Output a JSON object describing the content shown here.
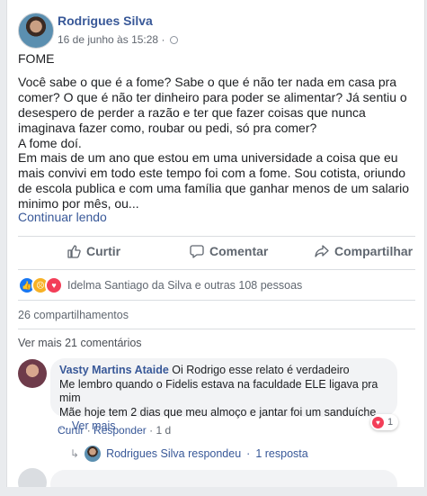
{
  "post": {
    "author": "Rodrigues Silva",
    "timestamp": "16 de junho às 15:28",
    "privacy_sep": "·",
    "title_line": "FOME",
    "paragraph1": "Você sabe o que é a fome? Sabe o que é não ter nada em casa pra comer? O que é não ter dinheiro para poder se alimentar? Já sentiu o desespero de perder a razão e ter que fazer coisas que nunca imaginava fazer como, roubar ou pedi, só pra comer?",
    "line2": "A fome doí.",
    "paragraph3": "Em mais de um ano que estou em uma universidade a coisa que eu mais convivi em todo este tempo foi com a fome. Sou cotista, oriundo de escola publica e com uma família que ganhar menos de um salario minimo por mês, ou...",
    "see_more": "Continuar lendo"
  },
  "actions": {
    "like": "Curtir",
    "comment": "Comentar",
    "share": "Compartilhar"
  },
  "reactions": {
    "icons": [
      "like-icon",
      "sad-icon",
      "love-icon"
    ],
    "summary": "Idelma Santiago da Silva e outras 108 pessoas"
  },
  "shares": "26 compartilhamentos",
  "view_more_comments": "Ver mais 21 comentários",
  "comment": {
    "author": "Vasty Martins Ataide",
    "line1": "Oi Rodrigo esse relato é verdadeiro",
    "line2": "Me lembro quando o Fidelis estava na faculdade ELE ligava pra mim",
    "line3": "Mãe hoje tem 2 dias que meu almoço e jantar foi um sanduíche",
    "see_more": "... Ver mais",
    "reaction_count": "1",
    "like_link": "Curtir",
    "sep": "·",
    "reply_link": "Responder",
    "age": "1 d"
  },
  "reply_summary": {
    "author": "Rodrigues Silva respondeu",
    "sep": "·",
    "count": "1 resposta"
  },
  "colors": {
    "link": "#385898",
    "like_blue": "#1877f2",
    "love_red": "#f33e58",
    "sad_yellow": "#f7b125"
  }
}
